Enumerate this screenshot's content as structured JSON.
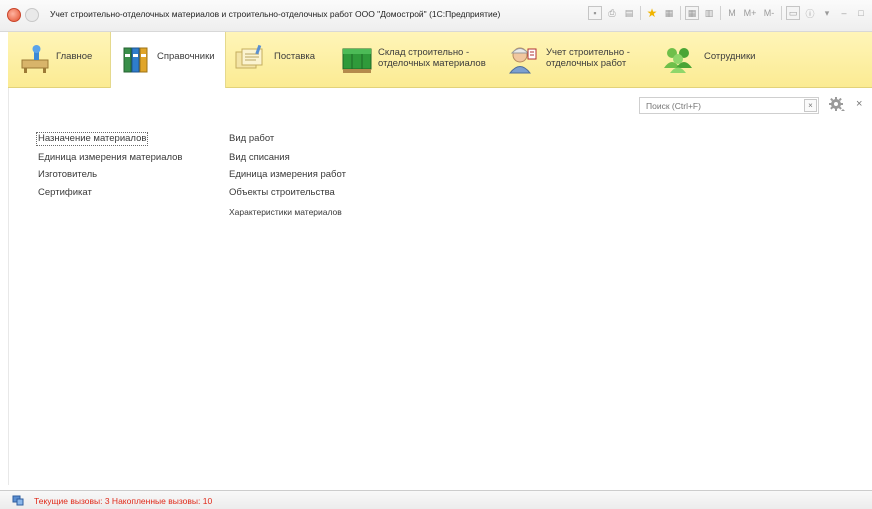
{
  "window": {
    "title": "Учет строительно-отделочных материалов и строительно-отделочных работ ООО \"Домострой\" (1С:Предприятие)",
    "tools": [
      "M",
      "M+",
      "M-"
    ]
  },
  "sections": [
    {
      "label_line1": "Главное",
      "label_line2": "",
      "icon": "desk-icon",
      "active": false
    },
    {
      "label_line1": "Справочники",
      "label_line2": "",
      "icon": "binders-icon",
      "active": true
    },
    {
      "label_line1": "Поставка",
      "label_line2": "",
      "icon": "documents-icon",
      "active": false
    },
    {
      "label_line1": "Склад строительно -",
      "label_line2": "отделочных материалов",
      "icon": "pallet-icon",
      "active": false
    },
    {
      "label_line1": "Учет строительно -",
      "label_line2": "отделочных работ",
      "icon": "worker-icon",
      "active": false
    },
    {
      "label_line1": "Сотрудники",
      "label_line2": "",
      "icon": "people-icon",
      "active": false
    }
  ],
  "search": {
    "placeholder": "Поиск (Ctrl+F)",
    "clear": "×"
  },
  "panel_close": "×",
  "commands": {
    "col1": [
      "Назначение материалов",
      "Единица измерения материалов",
      "Изготовитель",
      "Сертификат"
    ],
    "col2": [
      "Вид работ",
      "Вид списания",
      "Единица измерения работ",
      "Объекты строительства",
      "Характеристики материалов"
    ]
  },
  "status": {
    "text": "Текущие вызовы: 3   Накопленные вызовы: 10"
  },
  "colors": {
    "section_bg": "#fbeb93",
    "status_red": "#e02a1a"
  }
}
